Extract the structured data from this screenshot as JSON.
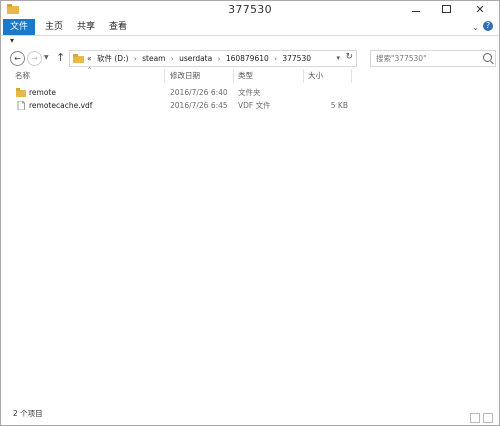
{
  "window": {
    "title": "377530"
  },
  "ribbon": {
    "tabs": [
      "文件",
      "主页",
      "共享",
      "查看"
    ]
  },
  "address": {
    "prefix": "«",
    "crumbs": [
      "软件 (D:)",
      "steam",
      "userdata",
      "160879610",
      "377530"
    ]
  },
  "search": {
    "placeholder": "搜索\"377530\""
  },
  "columns": {
    "name": "名称",
    "date": "修改日期",
    "type": "类型",
    "size": "大小"
  },
  "files": [
    {
      "icon": "folder-icon",
      "name": "remote",
      "date": "2016/7/26 6:40",
      "type": "文件夹",
      "size": ""
    },
    {
      "icon": "file-icon",
      "name": "remotecache.vdf",
      "date": "2016/7/26 6:45",
      "type": "VDF 文件",
      "size": "5 KB"
    }
  ],
  "status": {
    "count": "2 个项目"
  },
  "colors": {
    "file_tab": "#1979ca",
    "folder": "#e8b84a"
  }
}
